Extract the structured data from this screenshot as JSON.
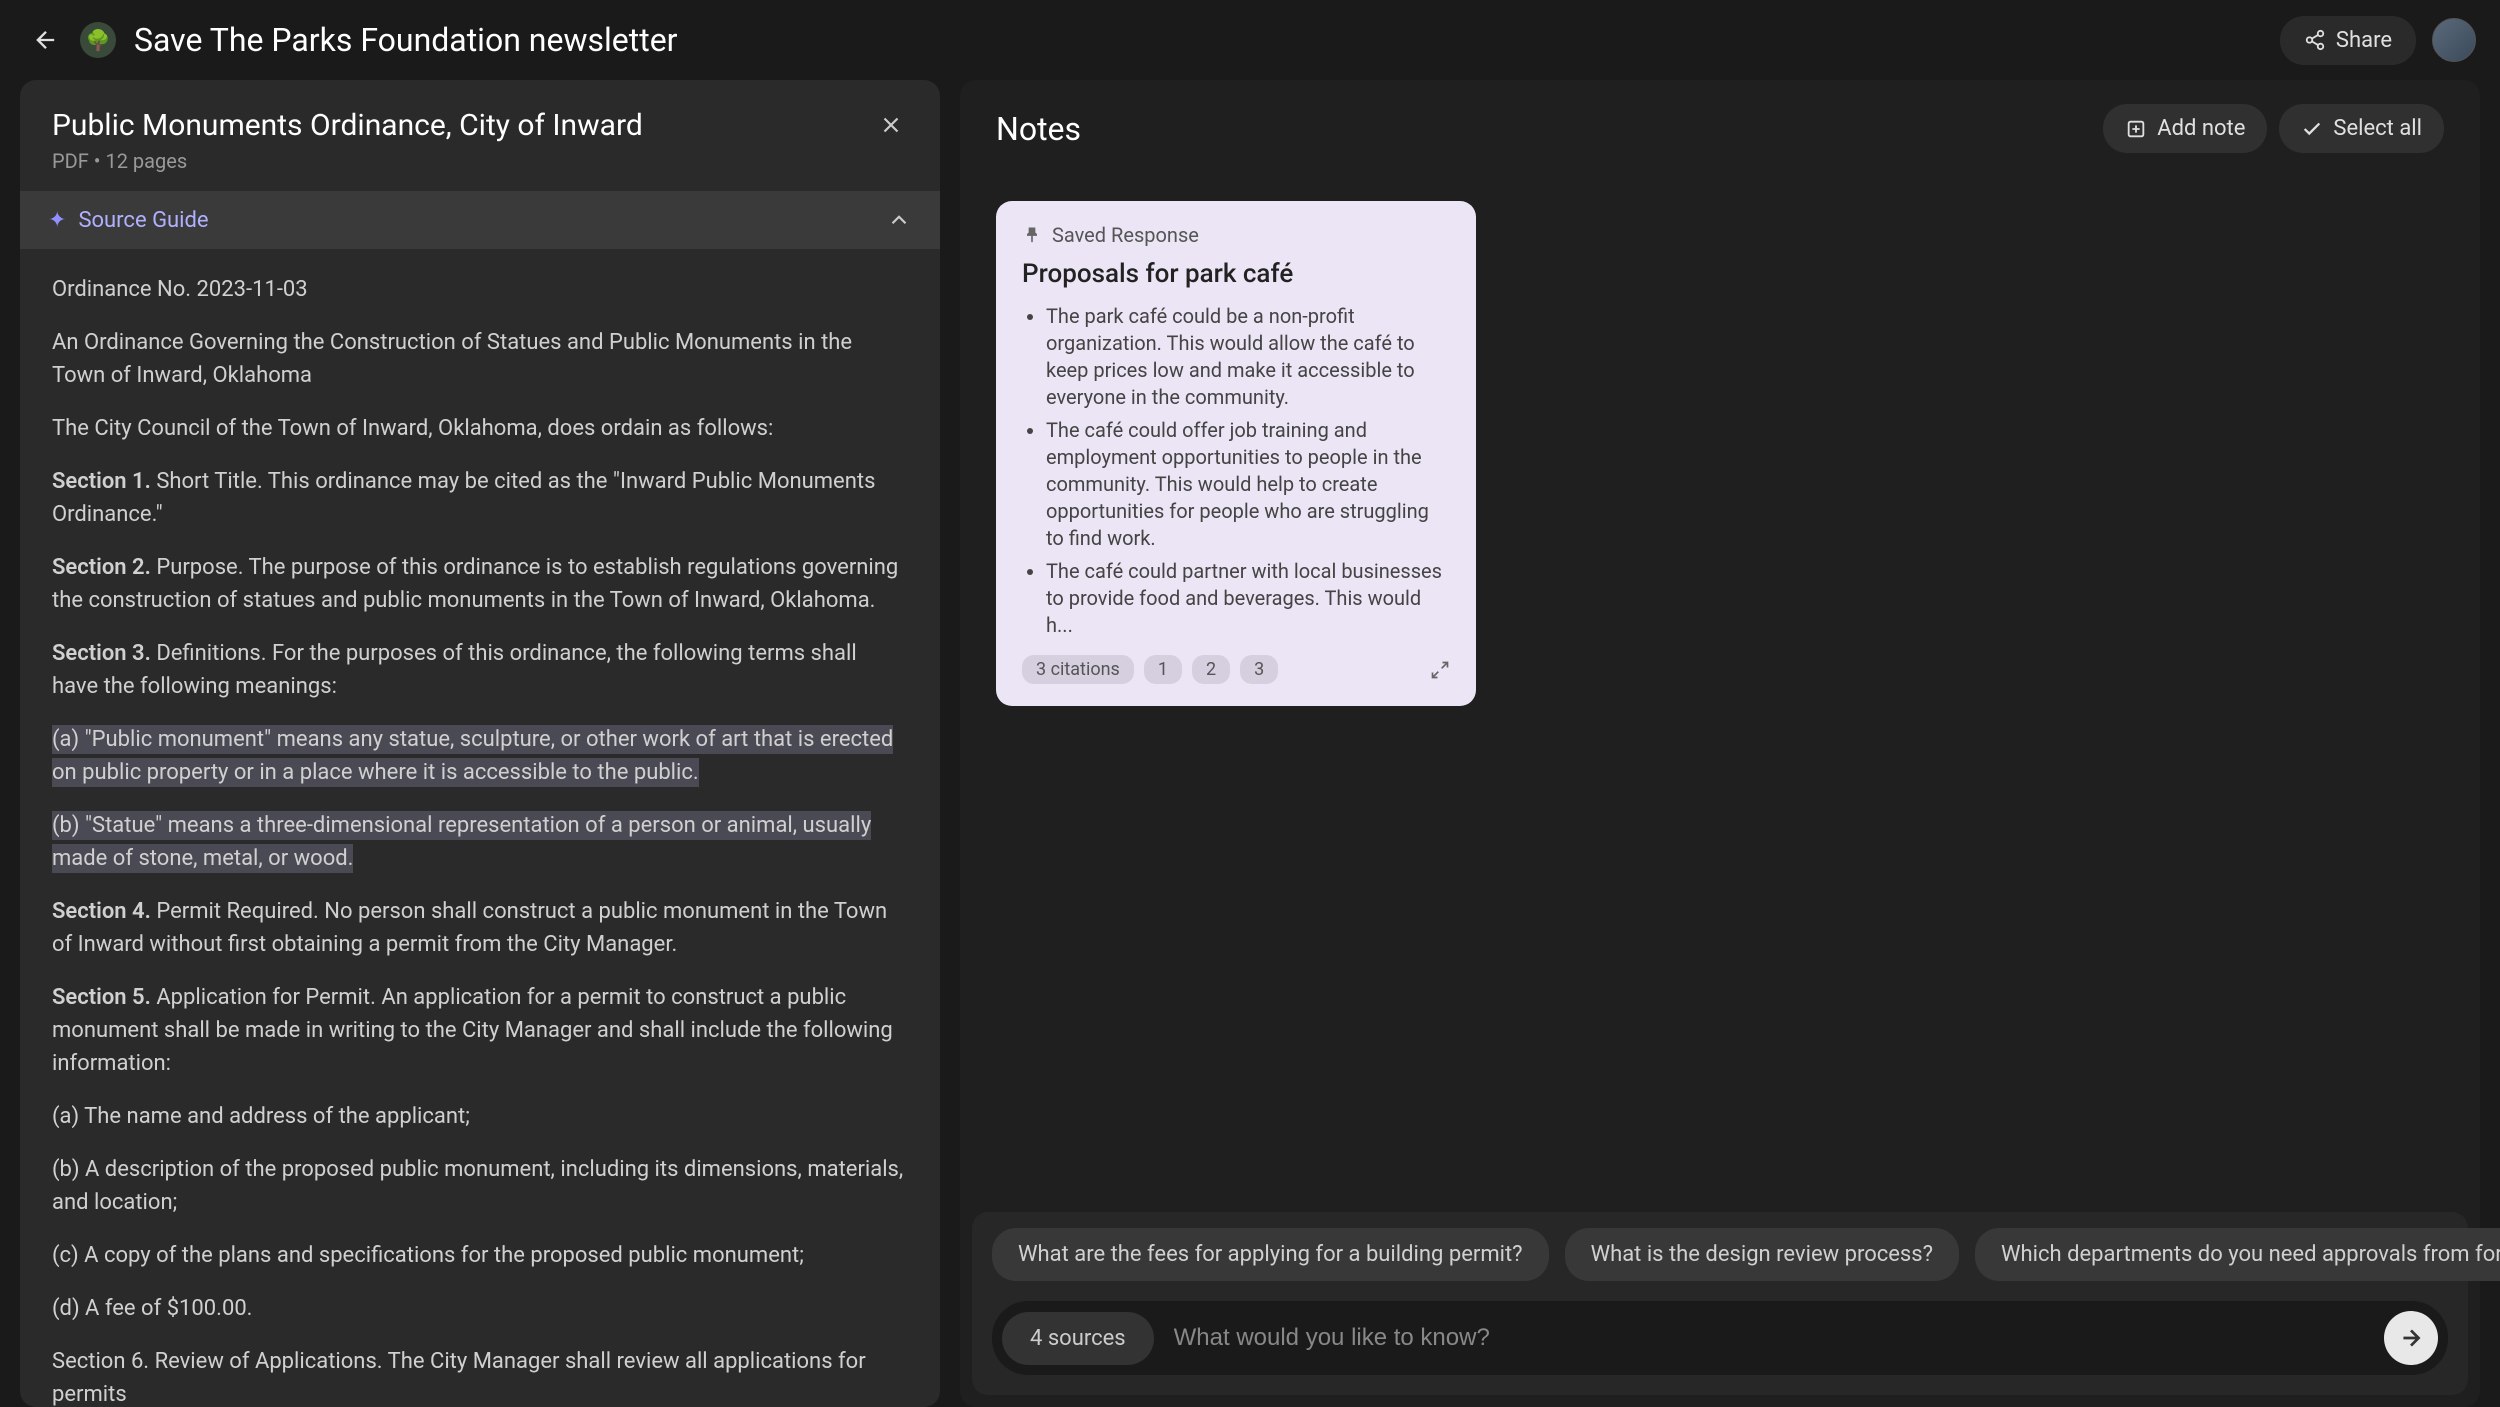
{
  "header": {
    "title": "Save The Parks Foundation newsletter",
    "share_label": "Share"
  },
  "left": {
    "title": "Public Monuments Ordinance, City of Inward",
    "meta": "PDF • 12 pages",
    "source_guide_label": "Source Guide",
    "body": {
      "ord_no": "Ordinance No. 2023-11-03",
      "intro": "An Ordinance Governing the Construction of Statues and Public Monuments in the Town of Inward, Oklahoma",
      "council": "The City Council of the Town of Inward, Oklahoma, does ordain as follows:",
      "s1_label": "Section 1.",
      "s1_text": " Short Title. This ordinance may be cited as the \"Inward Public Monuments Ordinance.\"",
      "s2_label": "Section 2.",
      "s2_text": " Purpose. The purpose of this ordinance is to establish regulations governing the construction of statues and public monuments in the Town of Inward, Oklahoma.",
      "s3_label": "Section 3.",
      "s3_text": " Definitions. For the purposes of this ordinance, the following terms shall have the following meanings:",
      "def_a": "(a) \"Public monument\" means any statue, sculpture, or other work of art that is erected on public property or in a place where it is accessible to the public.",
      "def_b": "(b) \"Statue\" means a three-dimensional representation of a person or animal, usually made of stone, metal, or wood.",
      "s4_label": "Section 4.",
      "s4_text": " Permit Required. No person shall construct a public monument in the Town of Inward without first obtaining a permit from the City Manager.",
      "s5_label": "Section 5.",
      "s5_text": " Application for Permit. An application for a permit to construct a public monument shall be made in writing to the City Manager and shall include the following information:",
      "s5_a": "(a) The name and address of the applicant;",
      "s5_b": "(b) A description of the proposed public monument, including its dimensions, materials, and location;",
      "s5_c": "(c) A copy of the plans and specifications for the proposed public monument;",
      "s5_d": "(d) A fee of $100.00.",
      "s6_partial": "Section 6. Review of Applications. The City Manager shall review all applications for permits"
    }
  },
  "right": {
    "title": "Notes",
    "add_note_label": "Add note",
    "select_all_label": "Select all"
  },
  "note": {
    "saved_label": "Saved Response",
    "title": "Proposals for park café",
    "bullets": [
      "The park café could be a non-profit organization. This would allow the café to keep prices low and make it accessible to everyone in the community.",
      "The café could offer job training and employment opportunities to people in the community. This would help to create opportunities for people who are struggling to find work.",
      "The café could partner with local businesses to provide food and beverages. This would h..."
    ],
    "citations_label": "3 citations",
    "cites": [
      "1",
      "2",
      "3"
    ]
  },
  "dock": {
    "suggestions": [
      "What are the fees for applying for a building permit?",
      "What is the design review process?",
      "Which departments do you need approvals from for monu..."
    ],
    "sources_label": "4 sources",
    "placeholder": "What would you like to know?"
  }
}
